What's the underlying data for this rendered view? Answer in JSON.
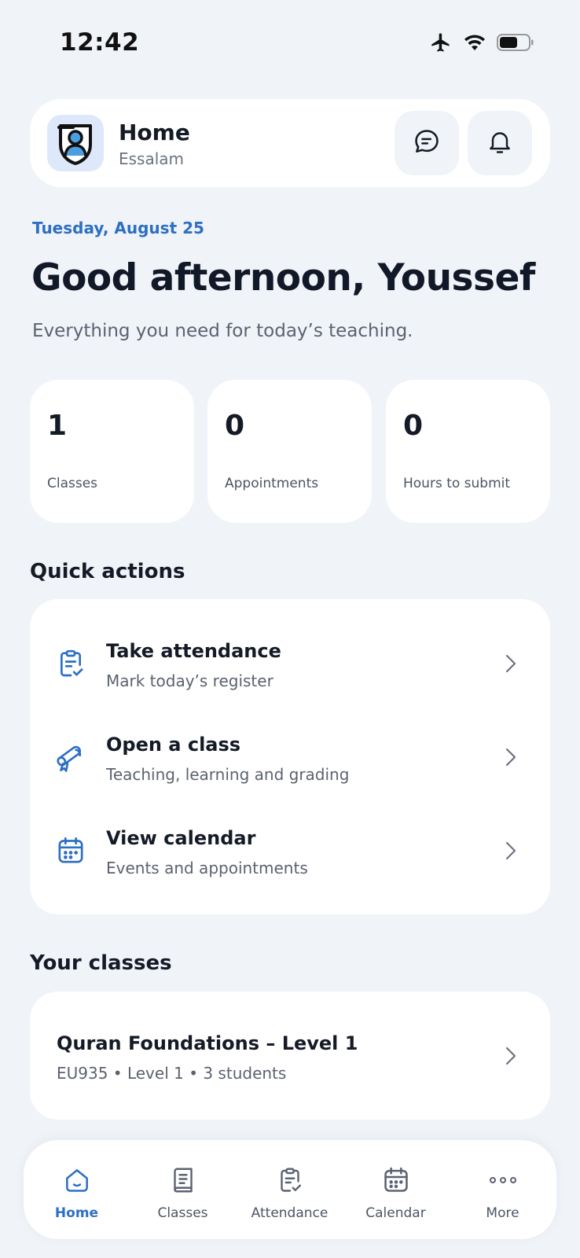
{
  "status_bar": {
    "time": "12:42",
    "icons": [
      "airplane-mode-icon",
      "wifi-icon",
      "battery-icon"
    ]
  },
  "header": {
    "title": "Home",
    "subtitle": "Essalam",
    "logo_icon": "school-logo-icon",
    "actions": [
      {
        "name": "messages",
        "icon": "chat-bubble-icon"
      },
      {
        "name": "notifications",
        "icon": "bell-icon"
      }
    ]
  },
  "date": "Tuesday, August 25",
  "greeting": "Good afternoon, Youssef",
  "subtitle": "Everything you need for today’s teaching.",
  "stats": [
    {
      "value": "1",
      "label": "Classes"
    },
    {
      "value": "0",
      "label": "Appointments"
    },
    {
      "value": "0",
      "label": "Hours to submit"
    }
  ],
  "quick_actions": {
    "title": "Quick actions",
    "items": [
      {
        "label": "Take attendance",
        "description": "Mark today’s register",
        "icon": "clipboard-check-icon"
      },
      {
        "label": "Open a class",
        "description": "Teaching, learning and grading",
        "icon": "diploma-icon"
      },
      {
        "label": "View calendar",
        "description": "Events and appointments",
        "icon": "calendar-icon"
      }
    ]
  },
  "your_classes": {
    "title": "Your classes",
    "items": [
      {
        "name": "Quran Foundations – Level 1",
        "meta": "EU935 • Level 1 • 3 students"
      }
    ]
  },
  "bottom_nav": {
    "active": "Home",
    "items": [
      {
        "label": "Home",
        "icon": "home-icon"
      },
      {
        "label": "Classes",
        "icon": "book-icon"
      },
      {
        "label": "Attendance",
        "icon": "clipboard-check-icon"
      },
      {
        "label": "Calendar",
        "icon": "calendar-icon"
      },
      {
        "label": "More",
        "icon": "more-dots-icon"
      }
    ]
  },
  "colors": {
    "background": "#f0f3f8",
    "card": "#ffffff",
    "accent": "#2d6fc4",
    "text": "#141a26",
    "muted": "#5b6270"
  }
}
